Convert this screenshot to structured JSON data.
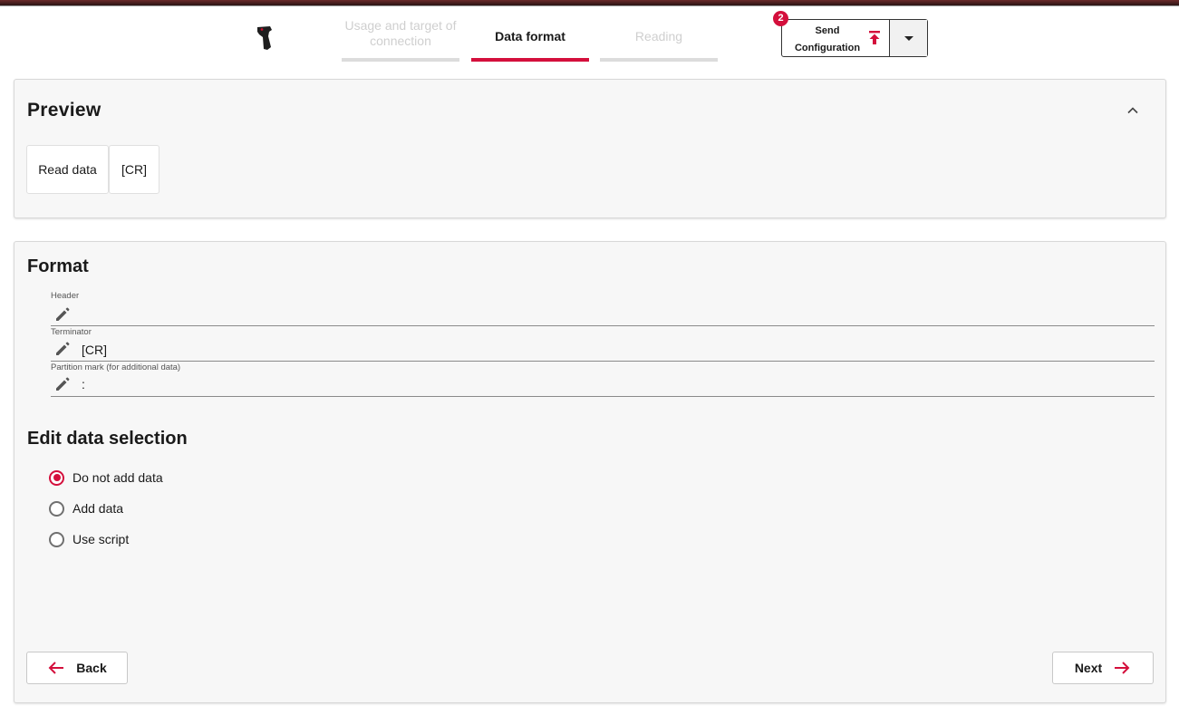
{
  "wizard": {
    "steps": [
      {
        "label": "Usage and target of connection",
        "state": "inactive"
      },
      {
        "label": "Data format",
        "state": "active"
      },
      {
        "label": "Reading",
        "state": "inactive"
      }
    ]
  },
  "send_config": {
    "label": "Send Configuration",
    "badge_count": "2",
    "icons": [
      "upload-icon",
      "chevron-down-icon"
    ]
  },
  "preview": {
    "title": "Preview",
    "chips": [
      "Read data",
      "[CR]"
    ]
  },
  "format": {
    "title": "Format",
    "fields": [
      {
        "label": "Header",
        "value": ""
      },
      {
        "label": "Terminator",
        "value": "[CR]"
      },
      {
        "label": "Partition mark (for additional data)",
        "value": ":"
      }
    ]
  },
  "edit_data": {
    "title": "Edit data selection",
    "options": [
      "Do not add data",
      "Add data",
      "Use script"
    ],
    "selected": "Do not add data"
  },
  "nav": {
    "back_label": "Back",
    "next_label": "Next"
  },
  "colors": {
    "accent": "#d40f3c",
    "panel_bg": "#f7f7f7",
    "inactive_text": "#cfcfcf"
  }
}
